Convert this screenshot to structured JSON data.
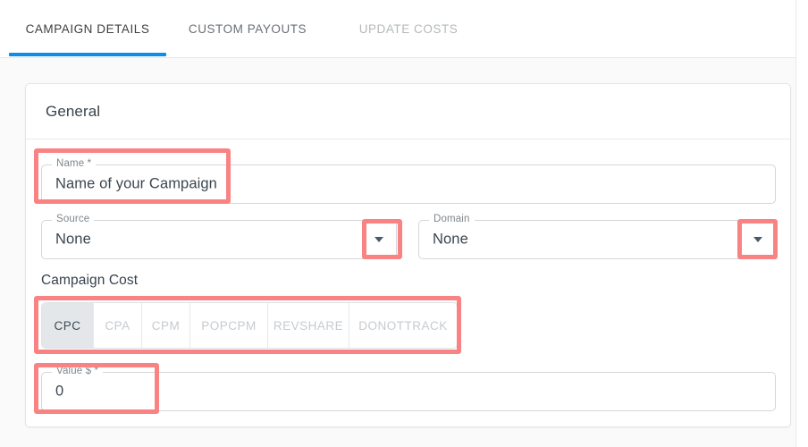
{
  "tabs": [
    {
      "label": "CAMPAIGN DETAILS",
      "state": "active"
    },
    {
      "label": "CUSTOM PAYOUTS",
      "state": "inactive"
    },
    {
      "label": "UPDATE COSTS",
      "state": "disabled"
    }
  ],
  "card": {
    "title": "General"
  },
  "form": {
    "name": {
      "label": "Name *",
      "value": "Name of your Campaign",
      "placeholder": "Name of your Campaign"
    },
    "source": {
      "label": "Source",
      "value": "None",
      "caret": "chevron-down-icon"
    },
    "domain": {
      "label": "Domain",
      "value": "None",
      "caret": "chevron-down-icon"
    },
    "value_field": {
      "label": "Value $ *",
      "value": "0",
      "placeholder": "0"
    }
  },
  "campaign_cost": {
    "section_title": "Campaign Cost",
    "options": [
      {
        "label": "CPC",
        "selected": true
      },
      {
        "label": "CPA",
        "selected": false
      },
      {
        "label": "CPM",
        "selected": false
      },
      {
        "label": "POPCPM",
        "selected": false
      },
      {
        "label": "REVSHARE",
        "selected": false
      },
      {
        "label": "DONOTTRACK",
        "selected": false
      }
    ]
  },
  "colors": {
    "accent_blue": "#0b8de8",
    "highlight": "#f98383",
    "active_tab_text": "#3c4043",
    "inactive_tab_text": "#6a7076",
    "disabled_tab_text": "#b4b9bd",
    "field_border": "#d3d6d9",
    "segment_active_bg": "#e3e7ea",
    "page_bg": "#fafafa"
  }
}
